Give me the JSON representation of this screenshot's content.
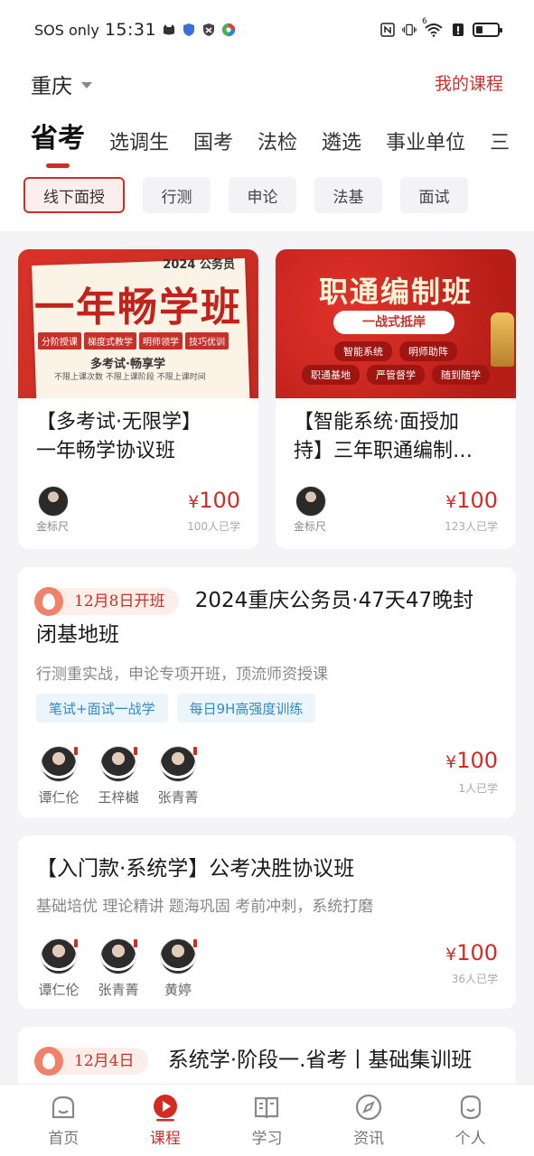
{
  "statusbar": {
    "carrier": "SOS only",
    "time": "15:31",
    "icons": [
      "cat-icon",
      "shield-icon",
      "vpn-icon",
      "app-icon"
    ],
    "right_icons": [
      "nfc-icon",
      "vibrate-icon",
      "wifi-icon",
      "alert-icon",
      "battery-icon"
    ],
    "wifi_label": "6"
  },
  "header": {
    "city": "重庆",
    "my_courses": "我的课程"
  },
  "tabs": [
    "省考",
    "选调生",
    "国考",
    "法检",
    "遴选",
    "事业单位",
    "三"
  ],
  "chips": [
    "线下面授",
    "行测",
    "申论",
    "法基",
    "面试"
  ],
  "colors": {
    "accent": "#c8312a",
    "price": "#d22b25",
    "pill_text": "#2f8bc4"
  },
  "top_cards": [
    {
      "thumb": {
        "year": "2024 公务员",
        "big": "一年畅学班",
        "tags": [
          "分阶授课",
          "梯度式教学",
          "明师领学",
          "技巧优训"
        ],
        "slogan": "多考试·畅享学",
        "fine": "不限上课次数 不限上课阶段 不限上课时间"
      },
      "title_line1": "【多考试·无限学】",
      "title_line2": "一年畅学协议班",
      "teacher": "金标尺",
      "price_symbol": "¥",
      "price": "100",
      "learners": "100人已学"
    },
    {
      "thumb": {
        "big": "职通编制班",
        "ribbon": "一战式抵岸",
        "row1": [
          "智能系统",
          "明师助阵"
        ],
        "row2": [
          "职通基地",
          "严管督学",
          "随到随学"
        ]
      },
      "title_line1": "【智能系统·面授加",
      "title_line2": "持】三年职通编制…",
      "teacher": "金标尺",
      "price_symbol": "¥",
      "price": "100",
      "learners": "123人已学"
    }
  ],
  "courses": [
    {
      "date": "12月8日开班",
      "title": "2024重庆公务员·47天47晚封闭基地班",
      "title_line1": "2024重庆公务员·47天47晚封",
      "title_line2": "闭基地班",
      "subtitle": "行测重实战，申论专项开班，顶流师资授课",
      "pills": [
        "笔试+面试一战学",
        "每日9H高强度训练"
      ],
      "teachers": [
        "谭仁伦",
        "王梓樾",
        "张青菁"
      ],
      "price_symbol": "¥",
      "price": "100",
      "learners": "1人已学"
    },
    {
      "title_line1": "【入门款·系统学】公考决胜协议班",
      "subtitle": "基础培优 理论精讲 题海巩固 考前冲刺，系统打磨",
      "teachers": [
        "谭仁伦",
        "张青菁",
        "黄婷"
      ],
      "price_symbol": "¥",
      "price": "100",
      "learners": "36人已学"
    },
    {
      "date": "12月4日",
      "title_line1": "系统学·阶段一.省考丨基础集训班"
    }
  ],
  "bottom_nav": [
    {
      "label": "首页",
      "icon": "home-icon"
    },
    {
      "label": "课程",
      "icon": "play-icon"
    },
    {
      "label": "学习",
      "icon": "book-icon"
    },
    {
      "label": "资讯",
      "icon": "compass-icon"
    },
    {
      "label": "个人",
      "icon": "profile-icon"
    }
  ]
}
